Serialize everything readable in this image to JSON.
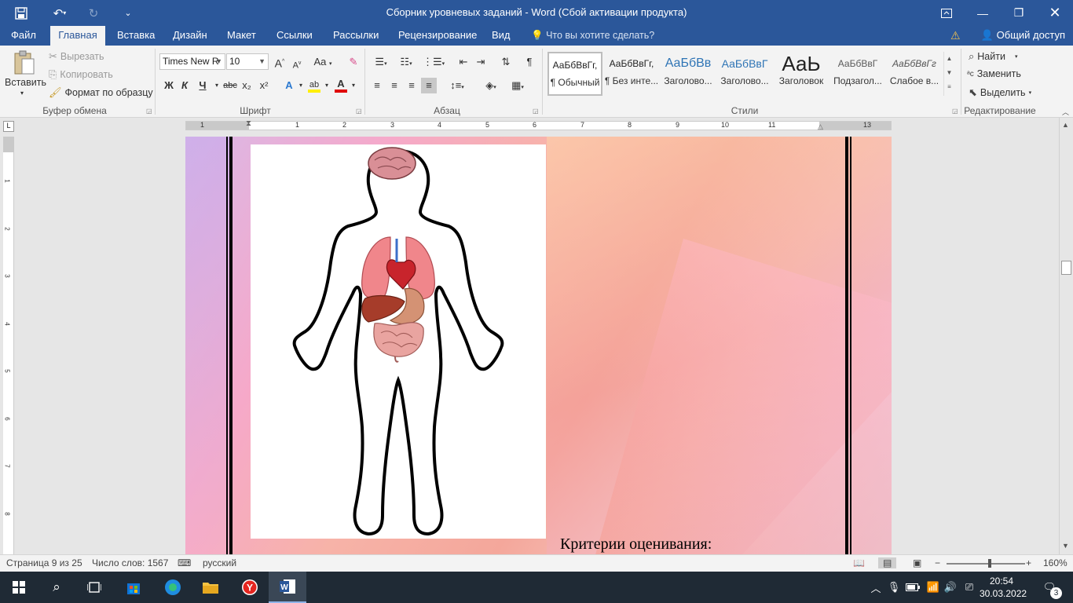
{
  "titlebar": {
    "title": "Сборник уровневых заданий - Word (Сбой активации продукта)",
    "icons": [
      "save-icon",
      "undo-icon",
      "redo-icon",
      "customize-icon",
      "ribbon-display-icon",
      "minimize-icon",
      "restore-icon",
      "close-icon"
    ]
  },
  "tabs": {
    "file": "Файл",
    "home": "Главная",
    "insert": "Вставка",
    "design": "Дизайн",
    "layout": "Макет",
    "references": "Ссылки",
    "mailings": "Рассылки",
    "review": "Рецензирование",
    "view": "Вид",
    "tell_me": "Что вы хотите сделать?",
    "share": "Общий доступ"
  },
  "clipboard": {
    "paste": "Вставить",
    "cut": "Вырезать",
    "copy": "Копировать",
    "format_painter": "Формат по образцу",
    "label": "Буфер обмена"
  },
  "font": {
    "name": "Times New R",
    "size": "10",
    "grow": "A",
    "shrink": "A",
    "case": "Aa",
    "bold": "Ж",
    "italic": "К",
    "underline": "Ч",
    "strike": "abc",
    "subscript": "x₂",
    "superscript": "x²",
    "label": "Шрифт"
  },
  "paragraph": {
    "label": "Абзац"
  },
  "styles": {
    "label": "Стили",
    "items": [
      {
        "sample": "АаБбВвГг,",
        "name": "¶ Обычный"
      },
      {
        "sample": "АаБбВвГг,",
        "name": "¶ Без инте..."
      },
      {
        "sample": "АаБбВв",
        "name": "Заголово..."
      },
      {
        "sample": "АаБбВвГ",
        "name": "Заголово..."
      },
      {
        "sample": "АаЬ",
        "name": "Заголовок"
      },
      {
        "sample": "АаБбВвГ",
        "name": "Подзагол..."
      },
      {
        "sample": "АаБбВвГг",
        "name": "Слабое в..."
      }
    ]
  },
  "editing": {
    "find": "Найти",
    "replace": "Заменить",
    "select": "Выделить",
    "label": "Редактирование"
  },
  "ruler": {
    "h_numbers": [
      "1",
      "1",
      "2",
      "3",
      "4",
      "5",
      "6",
      "7",
      "8",
      "9",
      "10",
      "11",
      "13"
    ],
    "v_numbers": [
      "1",
      "2",
      "3",
      "4",
      "5",
      "6",
      "7",
      "8"
    ]
  },
  "document": {
    "criteria": "Критерии оценивания:"
  },
  "status": {
    "page": "Страница 9 из 25",
    "words": "Число слов: 1567",
    "language": "русский",
    "zoom": "160%",
    "zoom_minus": "−",
    "zoom_plus": "+"
  },
  "taskbar": {
    "time": "20:54",
    "date": "30.03.2022",
    "notifications": "3"
  }
}
